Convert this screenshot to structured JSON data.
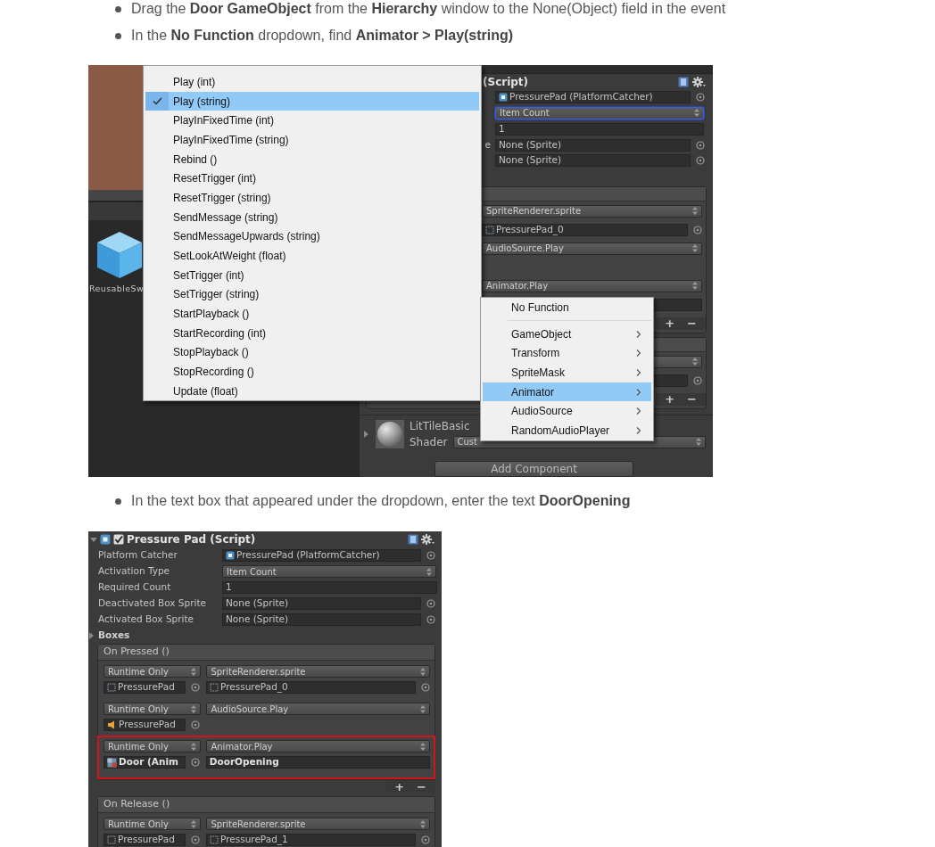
{
  "content": [
    {
      "kind": "bullet",
      "text": "Drag the **Door GameObject** from the **Hierarchy** window to the None(Object) field in the event"
    },
    {
      "kind": "bullet",
      "text": "In the **No Function** dropdown, find **Animator > Play(string)**"
    },
    {
      "kind": "menu_screenshot",
      "scene": {
        "object_label": "ReusableSw"
      },
      "inspector": {
        "title": "(Script)",
        "fields": [
          {
            "kind": "object",
            "value": "PressurePad (PlatformCatcher)",
            "icon": {
              "kind": "script"
            },
            "focused": false
          },
          {
            "kind": "dropdown",
            "value": "Item Count",
            "focused": true
          },
          {
            "kind": "text",
            "value": "1",
            "focused": false
          },
          {
            "kind": "object",
            "label": "e",
            "value": "None (Sprite)",
            "focused": false
          },
          {
            "kind": "object",
            "value": "None (Sprite)",
            "focused": false
          }
        ],
        "event_rows": [
          {
            "kind": "header"
          },
          {
            "kind": "method",
            "value": "SpriteRenderer.sprite"
          },
          {
            "kind": "object_arg",
            "value": "PressurePad_0",
            "icon": {
              "kind": "sprite"
            }
          },
          {
            "kind": "method",
            "value": "AudioSource.Play"
          },
          {
            "kind": "blank"
          },
          {
            "kind": "method",
            "value": "Animator.Play"
          },
          {
            "kind": "string_arg"
          },
          {
            "kind": "footer",
            "add": "+",
            "remove": "−"
          },
          {
            "kind": "header"
          },
          {
            "kind": "method"
          },
          {
            "kind": "object_arg"
          },
          {
            "kind": "footer",
            "add": "+",
            "remove": "−"
          }
        ],
        "material": {
          "name": "LitTileBasic",
          "expanded": false,
          "shader_label": "Shader",
          "shader_value": "Cust"
        },
        "add_button": "Add Component"
      },
      "method_menu": {
        "items": [
          {
            "label": "Play (int)",
            "selected": false
          },
          {
            "label": "Play (string)",
            "selected": true
          },
          {
            "label": "PlayInFixedTime (int)",
            "selected": false
          },
          {
            "label": "PlayInFixedTime (string)",
            "selected": false
          },
          {
            "label": "Rebind ()",
            "selected": false
          },
          {
            "label": "ResetTrigger (int)",
            "selected": false
          },
          {
            "label": "ResetTrigger (string)",
            "selected": false
          },
          {
            "label": "SendMessage (string)",
            "selected": false
          },
          {
            "label": "SendMessageUpwards (string)",
            "selected": false
          },
          {
            "label": "SetLookAtWeight (float)",
            "selected": false
          },
          {
            "label": "SetTrigger (int)",
            "selected": false
          },
          {
            "label": "SetTrigger (string)",
            "selected": false
          },
          {
            "label": "StartPlayback ()",
            "selected": false
          },
          {
            "label": "StartRecording (int)",
            "selected": false
          },
          {
            "label": "StopPlayback ()",
            "selected": false
          },
          {
            "label": "StopRecording ()",
            "selected": false
          },
          {
            "label": "Update (float)",
            "selected": false
          }
        ]
      },
      "component_menu": {
        "items": [
          {
            "label": "No Function",
            "kind": "action",
            "selected": false
          },
          {
            "label": "GameObject",
            "kind": "group",
            "selected": false
          },
          {
            "label": "Transform",
            "kind": "group",
            "selected": false
          },
          {
            "label": "SpriteMask",
            "kind": "group",
            "selected": false
          },
          {
            "label": "Animator",
            "kind": "group",
            "selected": true
          },
          {
            "label": "AudioSource",
            "kind": "group",
            "selected": false
          },
          {
            "label": "RandomAudioPlayer",
            "kind": "group",
            "selected": false
          }
        ]
      }
    },
    {
      "kind": "bullet",
      "text": "In the text box that appeared under the dropdown, enter the text **DoorOpening**"
    },
    {
      "kind": "inspector_screenshot",
      "title": "Pressure Pad (Script)",
      "expanded": true,
      "enabled": true,
      "fields": [
        {
          "label": "Platform Catcher",
          "kind": "object",
          "value": "PressurePad (PlatformCatcher)",
          "icon": {
            "kind": "script"
          },
          "focused": false
        },
        {
          "label": "Activation Type",
          "kind": "dropdown",
          "value": "Item Count",
          "focused": false
        },
        {
          "label": "Required Count",
          "kind": "text",
          "value": "1",
          "focused": false
        },
        {
          "label": "Deactivated Box Sprite",
          "kind": "object",
          "value": "None (Sprite)",
          "focused": false
        },
        {
          "label": "Activated Box Sprite",
          "kind": "object",
          "value": "None (Sprite)",
          "focused": false
        }
      ],
      "list": {
        "label": "Boxes",
        "expanded": false
      },
      "events": [
        {
          "title": "On Pressed ()",
          "entries": [
            {
              "mode": "Runtime Only",
              "method": "SpriteRenderer.sprite",
              "target": {
                "kind": "sprite",
                "text": "PressurePad"
              },
              "argument": {
                "kind": "object",
                "text": "PressurePad_0"
              },
              "highlighted": false,
              "overridden": false
            },
            {
              "mode": "Runtime Only",
              "method": "AudioSource.Play",
              "target": {
                "kind": "audio",
                "text": "PressurePad"
              },
              "highlighted": false,
              "overridden": false
            },
            {
              "mode": "Runtime Only",
              "method": "Animator.Play",
              "target": {
                "kind": "animator",
                "text": "Door (Anim"
              },
              "argument": {
                "kind": "string",
                "text": "DoorOpening"
              },
              "highlighted": true,
              "overridden": true
            }
          ],
          "footer": {
            "add": "+",
            "remove": "−"
          }
        },
        {
          "title": "On Release ()",
          "entries": [
            {
              "mode": "Runtime Only",
              "method": "SpriteRenderer.sprite",
              "target": {
                "kind": "sprite",
                "text": "PressurePad"
              },
              "argument": {
                "kind": "object",
                "text": "PressurePad_1"
              },
              "highlighted": false,
              "overridden": false
            }
          ]
        }
      ]
    }
  ]
}
